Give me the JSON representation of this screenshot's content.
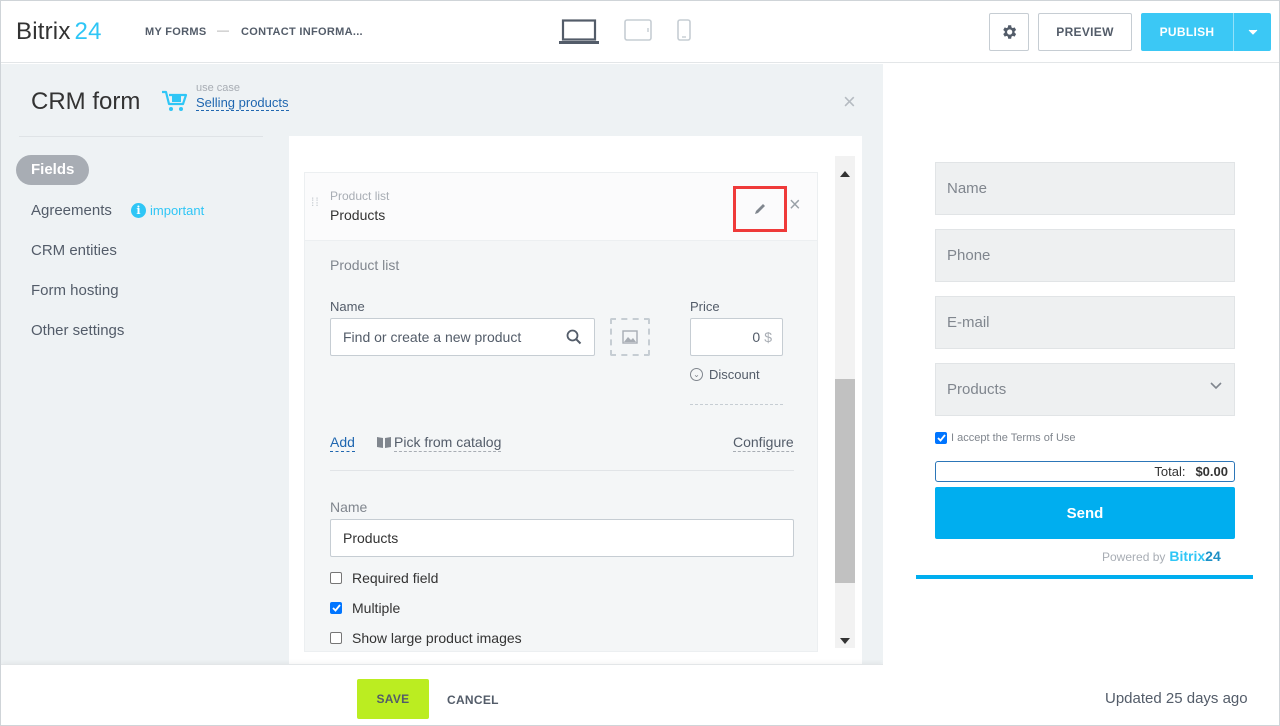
{
  "header": {
    "logo_text": "Bitrix",
    "logo_num": "24",
    "breadcrumb_1": "MY FORMS",
    "breadcrumb_sep": "—",
    "breadcrumb_2": "CONTACT INFORMA...",
    "preview_label": "PREVIEW",
    "publish_label": "PUBLISH",
    "devices": [
      "laptop-icon",
      "tablet-icon",
      "phone-icon"
    ]
  },
  "editor": {
    "title": "CRM form",
    "usecase_small": "use case",
    "usecase_link": "Selling products",
    "close_symbol": "×"
  },
  "nav": {
    "items": [
      {
        "label": "Fields",
        "active": true
      },
      {
        "label": "Agreements"
      },
      {
        "label": "CRM entities"
      },
      {
        "label": "Form hosting"
      },
      {
        "label": "Other settings"
      }
    ],
    "important_label": "important",
    "important_icon_glyph": "i"
  },
  "field_card": {
    "subtitle": "Product list",
    "title": "Products",
    "close_symbol": "×",
    "section_label": "Product list",
    "name_label": "Name",
    "search_placeholder": "Find or create a new product",
    "price_label": "Price",
    "price_value": "0",
    "currency": "$",
    "discount_label": "Discount",
    "add_link": "Add",
    "catalog_link": "Pick from catalog",
    "configure_link": "Configure",
    "field_name_label": "Name",
    "field_name_value": "Products",
    "options": [
      {
        "label": "Required field",
        "checked": false
      },
      {
        "label": "Multiple",
        "checked": true
      },
      {
        "label": "Show large product images",
        "checked": false
      }
    ]
  },
  "footer": {
    "save_label": "SAVE",
    "cancel_label": "CANCEL"
  },
  "preview": {
    "fields": [
      "Name",
      "Phone",
      "E-mail"
    ],
    "select_label": "Products",
    "terms_label": "I accept the Terms of Use",
    "total_label": "Total:",
    "total_value": "$0.00",
    "send_label": "Send",
    "powered_label": "Powered by",
    "brand_text": "Bitrix",
    "brand_num": "24",
    "updated": "Updated 25 days ago"
  },
  "colors": {
    "accent": "#2fc6f6",
    "publish": "#3bc8f5",
    "save": "#bbed21",
    "send": "#00aeef",
    "highlight": "#ef3a3a"
  }
}
